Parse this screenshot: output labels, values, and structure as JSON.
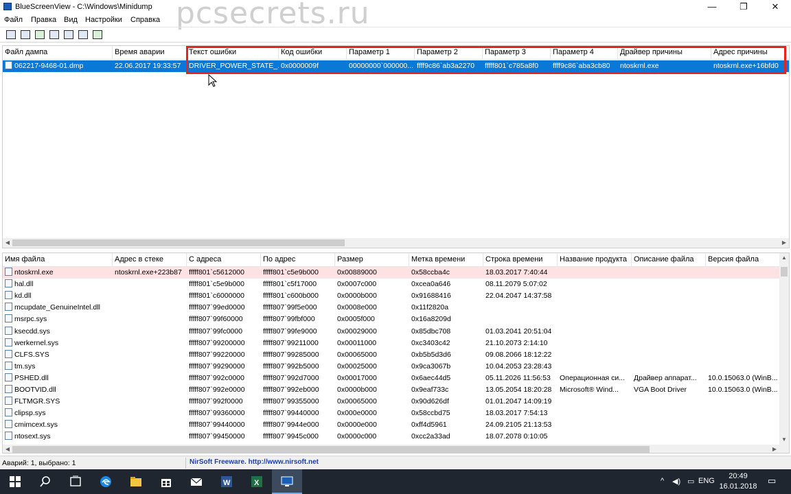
{
  "window": {
    "title": "BlueScreenView  -  C:\\Windows\\Minidump",
    "minimize": "—",
    "maximize": "❐",
    "close": "✕"
  },
  "watermark": "pcsecrets.ru",
  "menu": [
    "Файл",
    "Правка",
    "Вид",
    "Настройки",
    "Справка"
  ],
  "toolbar": [
    "html-report-icon",
    "save-icon",
    "refresh-icon",
    "copy-icon",
    "properties-icon",
    "find-icon",
    "exit-icon"
  ],
  "top_table": {
    "columns": [
      "Файл дампа",
      "Время аварии",
      "Текст ошибки",
      "Код ошибки",
      "Параметр 1",
      "Параметр 2",
      "Параметр 3",
      "Параметр 4",
      "Драйвер причины",
      "Адрес причины",
      ""
    ],
    "rows": [
      [
        "062217-9468-01.dmp",
        "22.06.2017 19:33:57",
        "DRIVER_POWER_STATE_...",
        "0x0000009f",
        "00000000`000000...",
        "ffff9c86`ab3a2270",
        "fffff801`c785a8f0",
        "ffff9c86`aba3cb80",
        "ntoskrnl.exe",
        "ntoskrnl.exe+16bfd0",
        ""
      ]
    ]
  },
  "bottom_table": {
    "columns": [
      "Имя файла",
      "Адрес в стеке",
      "С адреса",
      "По адрес",
      "Размер",
      "Метка времени",
      "Строка времени",
      "Название продукта",
      "Описание файла",
      "Версия файла"
    ],
    "rows": [
      [
        "ntoskrnl.exe",
        "ntoskrnl.exe+223b87",
        "fffff801`c5612000",
        "fffff801`c5e9b000",
        "0x00889000",
        "0x58ccba4c",
        "18.03.2017 7:40:44",
        "",
        "",
        ""
      ],
      [
        "hal.dll",
        "",
        "fffff801`c5e9b000",
        "fffff801`c5f17000",
        "0x0007c000",
        "0xcea0a646",
        "08.11.2079 5:07:02",
        "",
        "",
        ""
      ],
      [
        "kd.dll",
        "",
        "fffff801`c6000000",
        "fffff801`c600b000",
        "0x0000b000",
        "0x91688416",
        "22.04.2047 14:37:58",
        "",
        "",
        ""
      ],
      [
        "mcupdate_GenuineIntel.dll",
        "",
        "fffff807`99ed0000",
        "fffff807`99f5e000",
        "0x0008e000",
        "0x11f2820a",
        "",
        "",
        "",
        ""
      ],
      [
        "msrpc.sys",
        "",
        "fffff807`99f60000",
        "fffff807`99fbf000",
        "0x0005f000",
        "0x16a8209d",
        "",
        "",
        "",
        ""
      ],
      [
        "ksecdd.sys",
        "",
        "fffff807`99fc0000",
        "fffff807`99fe9000",
        "0x00029000",
        "0x85dbc708",
        "01.03.2041 20:51:04",
        "",
        "",
        ""
      ],
      [
        "werkernel.sys",
        "",
        "fffff807`99200000",
        "fffff807`99211000",
        "0x00011000",
        "0xc3403c42",
        "21.10.2073 2:14:10",
        "",
        "",
        ""
      ],
      [
        "CLFS.SYS",
        "",
        "fffff807`99220000",
        "fffff807`99285000",
        "0x00065000",
        "0xb5b5d3d6",
        "09.08.2066 18:12:22",
        "",
        "",
        ""
      ],
      [
        "tm.sys",
        "",
        "fffff807`99290000",
        "fffff807`992b5000",
        "0x00025000",
        "0x9ca3067b",
        "10.04.2053 23:28:43",
        "",
        "",
        ""
      ],
      [
        "PSHED.dll",
        "",
        "fffff807`992c0000",
        "fffff807`992d7000",
        "0x00017000",
        "0x6aec44d5",
        "05.11.2026 11:56:53",
        "Операционная си...",
        "Драйвер аппарат...",
        "10.0.15063.0 (WinB..."
      ],
      [
        "BOOTVID.dll",
        "",
        "fffff807`992e0000",
        "fffff807`992eb000",
        "0x0000b000",
        "0x9eaf733c",
        "13.05.2054 18:20:28",
        "Microsoft® Wind...",
        "VGA Boot Driver",
        "10.0.15063.0 (WinB..."
      ],
      [
        "FLTMGR.SYS",
        "",
        "fffff807`992f0000",
        "fffff807`99355000",
        "0x00065000",
        "0x90d626df",
        "01.01.2047 14:09:19",
        "",
        "",
        ""
      ],
      [
        "clipsp.sys",
        "",
        "fffff807`99360000",
        "fffff807`99440000",
        "0x000e0000",
        "0x58ccbd75",
        "18.03.2017 7:54:13",
        "",
        "",
        ""
      ],
      [
        "cmimcext.sys",
        "",
        "fffff807`99440000",
        "fffff807`9944e000",
        "0x0000e000",
        "0xff4d5961",
        "24.09.2105 21:13:53",
        "",
        "",
        ""
      ],
      [
        "ntosext.sys",
        "",
        "fffff807`99450000",
        "fffff807`9945c000",
        "0x0000c000",
        "0xcc2a33ad",
        "18.07.2078 0:10:05",
        "",
        "",
        ""
      ]
    ]
  },
  "status": {
    "left": "Аварий: 1, выбрано: 1",
    "center": "NirSoft Freeware.  http://www.nirsoft.net"
  },
  "taskbar": {
    "apps": [
      "start-icon",
      "search-icon",
      "task-view-icon",
      "edge-icon",
      "explorer-icon",
      "store-icon",
      "mail-icon",
      "word-icon",
      "excel-icon",
      "bluescreenview-icon"
    ],
    "lang": "ENG",
    "time": "20:49",
    "date": "16.01.2018"
  },
  "colors": {
    "selection": "#0a78d7",
    "highlight_row": "#fde2e4",
    "annotation_box": "#e8231e",
    "taskbar": "#1f2630"
  }
}
